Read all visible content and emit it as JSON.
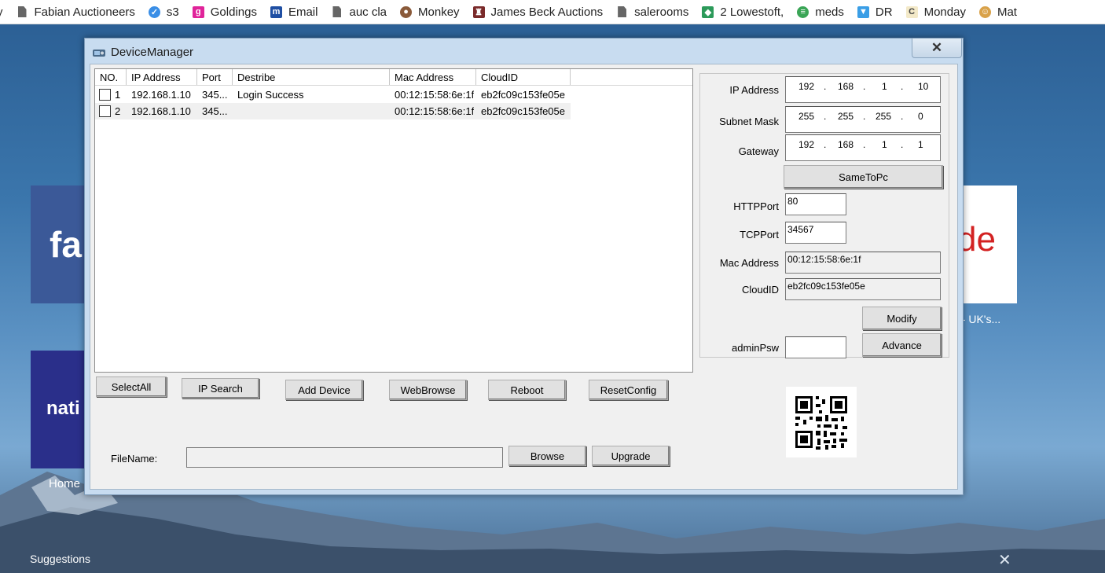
{
  "bookmarks": [
    {
      "label": "y",
      "icon": "none"
    },
    {
      "label": "Fabian Auctioneers",
      "icon": "document-icon"
    },
    {
      "label": "s3",
      "icon": "bird-icon"
    },
    {
      "label": "Goldings",
      "icon": "g-logo-icon"
    },
    {
      "label": "Email",
      "icon": "m-logo-icon"
    },
    {
      "label": "auc cla",
      "icon": "document-icon"
    },
    {
      "label": "Monkey",
      "icon": "monkey-icon"
    },
    {
      "label": "James Beck Auctions",
      "icon": "gavel-icon"
    },
    {
      "label": "salerooms",
      "icon": "document-icon"
    },
    {
      "label": "2 Lowestoft,",
      "icon": "cube-icon"
    },
    {
      "label": "meds",
      "icon": "leaf-icon"
    },
    {
      "label": "DR",
      "icon": "funnel-icon"
    },
    {
      "label": "Monday",
      "icon": "c-logo-icon"
    },
    {
      "label": "Mat",
      "icon": "avatar-icon"
    }
  ],
  "desktop": {
    "tile_left_top": "fa",
    "tile_left_bottom": "nati",
    "tile_right": "de",
    "home_label": "Home",
    "right_caption": "; - UK's...",
    "suggestions_label": "Suggestions",
    "dismiss_icon": "close-icon"
  },
  "window": {
    "title": "DeviceManager",
    "close_glyph": "✕"
  },
  "list": {
    "columns": [
      "NO.",
      "IP Address",
      "Port",
      "Destribe",
      "Mac Address",
      "CloudID"
    ],
    "rows": [
      {
        "no": "1",
        "ip": "192.168.1.10",
        "port": "345...",
        "describe": "Login Success",
        "mac": "00:12:15:58:6e:1f",
        "cloud": "eb2fc09c153fe05e"
      },
      {
        "no": "2",
        "ip": "192.168.1.10",
        "port": "345...",
        "describe": "",
        "mac": "00:12:15:58:6e:1f",
        "cloud": "eb2fc09c153fe05e"
      }
    ]
  },
  "actions": {
    "select_all": "SelectAll",
    "ip_search": "IP Search",
    "add_device": "Add Device",
    "web_browse": "WebBrowse",
    "reboot": "Reboot",
    "reset_config": "ResetConfig"
  },
  "file": {
    "label": "FileName:",
    "value": "",
    "browse": "Browse",
    "upgrade": "Upgrade"
  },
  "config": {
    "ip_label": "IP Address",
    "ip": [
      "192",
      "168",
      "1",
      "10"
    ],
    "subnet_label": "Subnet Mask",
    "subnet": [
      "255",
      "255",
      "255",
      "0"
    ],
    "gateway_label": "Gateway",
    "gateway": [
      "192",
      "168",
      "1",
      "1"
    ],
    "dot": ".",
    "same_to_pc": "SameToPc",
    "http_label": "HTTPPort",
    "http": "80",
    "tcp_label": "TCPPort",
    "tcp": "34567",
    "mac_label": "Mac Address",
    "mac": "00:12:15:58:6e:1f",
    "cloud_label": "CloudID",
    "cloud": "eb2fc09c153fe05e",
    "modify": "Modify",
    "admin_label": "adminPsw",
    "admin_value": "",
    "advance": "Advance"
  },
  "colors": {
    "window_frame": "#c8dcf0",
    "client_bg": "#f0f0f0",
    "facebook_tile": "#3b5998",
    "nat_tile": "#2a2f8a"
  }
}
